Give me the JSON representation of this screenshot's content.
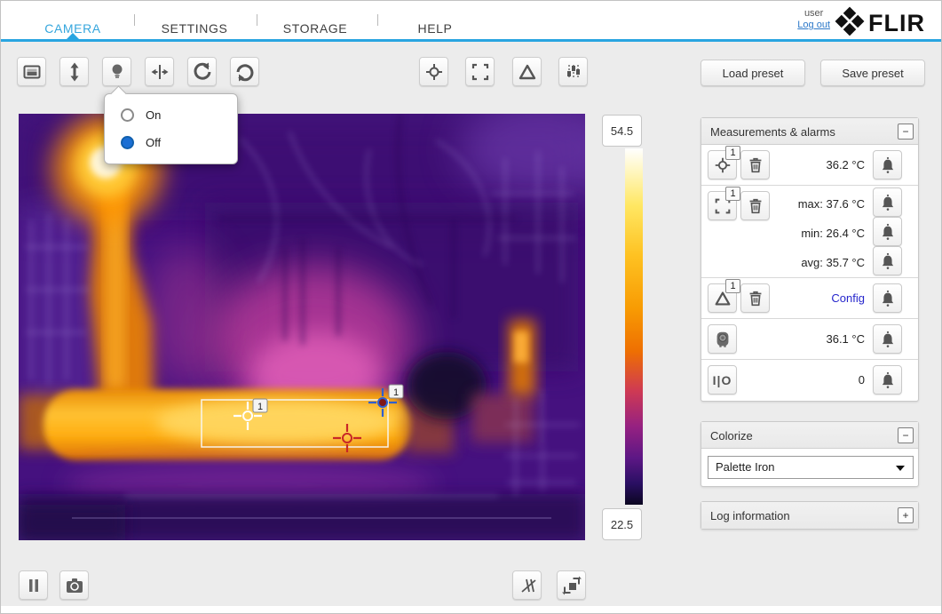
{
  "header": {
    "tabs": [
      {
        "label": "CAMERA",
        "active": true
      },
      {
        "label": "SETTINGS",
        "active": false
      },
      {
        "label": "STORAGE",
        "active": false
      },
      {
        "label": "HELP",
        "active": false
      }
    ],
    "user_label": "user",
    "logout_label": "Log out",
    "brand": "FLIR"
  },
  "toolbar": {
    "load_preset_label": "Load preset",
    "save_preset_label": "Save preset"
  },
  "lamp_popup": {
    "options": [
      {
        "label": "On",
        "selected": false
      },
      {
        "label": "Off",
        "selected": true
      }
    ]
  },
  "scale": {
    "max": "54.5",
    "min": "22.5"
  },
  "panels": {
    "measurements": {
      "title": "Measurements & alarms",
      "collapse_label": "−",
      "spot": {
        "badge": "1",
        "value": "36.2 °C"
      },
      "box": {
        "badge": "1",
        "rows": [
          {
            "text": "max: 37.6 °C"
          },
          {
            "text": "min: 26.4 °C"
          },
          {
            "text": "avg: 35.7 °C"
          }
        ]
      },
      "delta": {
        "badge": "1",
        "link_label": "Config"
      },
      "housing": {
        "value": "36.1 °C"
      },
      "digital_io": {
        "icon_label": "I|O",
        "value": "0"
      }
    },
    "colorize": {
      "title": "Colorize",
      "collapse_label": "−",
      "palette_value": "Palette Iron"
    },
    "log": {
      "title": "Log information",
      "expand_label": "+"
    }
  },
  "image": {
    "spot_marker_badge": "1",
    "box_marker_badge": "1"
  },
  "colors": {
    "accent_blue": "#29a5e1",
    "link_blue": "#2626cc",
    "radio_selected": "#1b6fd4"
  }
}
